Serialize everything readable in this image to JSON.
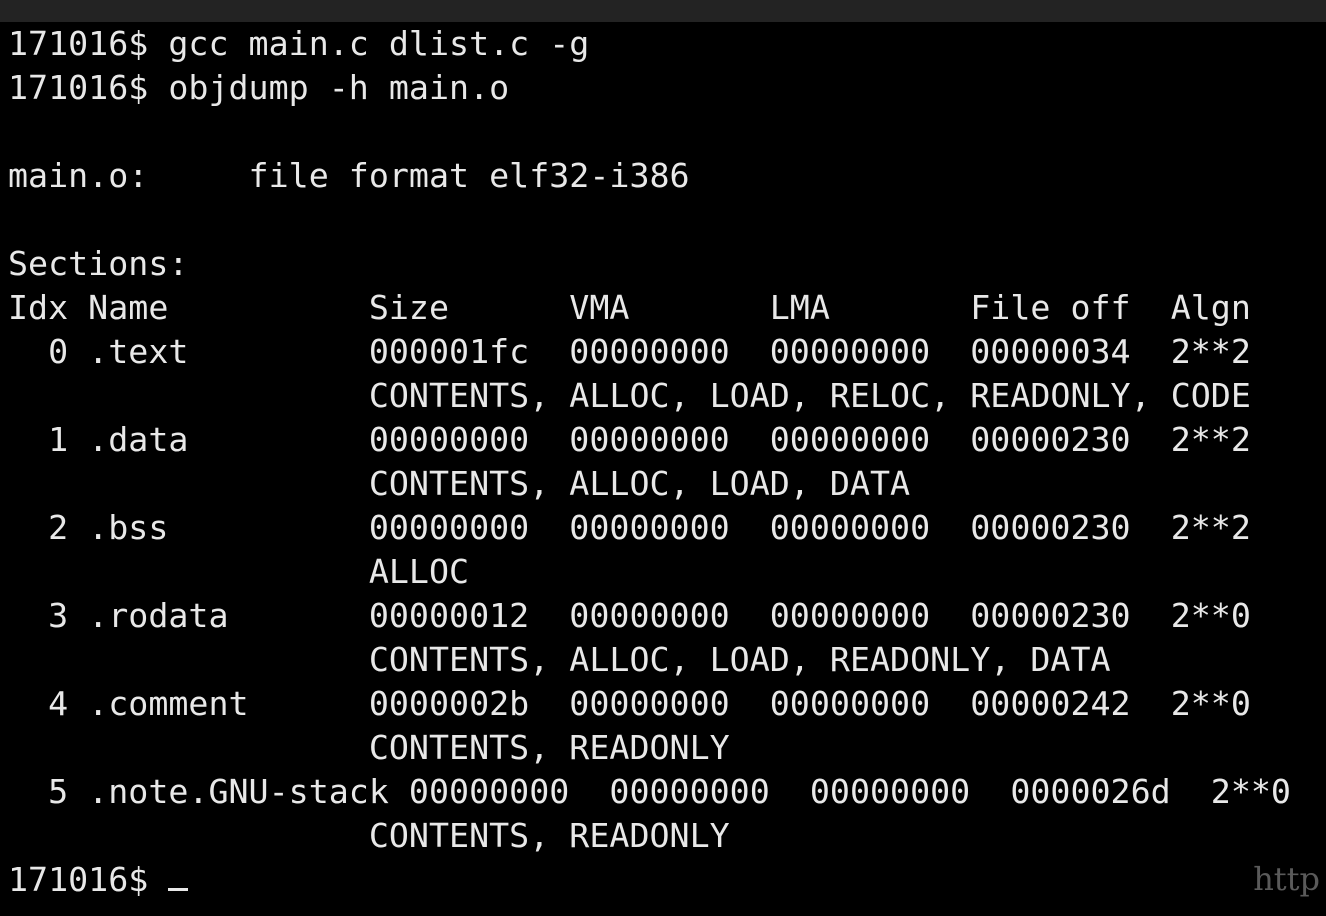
{
  "terminal": {
    "lines": [
      "171016$ gcc main.c dlist.c -g",
      "171016$ objdump -h main.o",
      "",
      "main.o:     file format elf32-i386",
      "",
      "Sections:",
      "Idx Name          Size      VMA       LMA       File off  Algn",
      "  0 .text         000001fc  00000000  00000000  00000034  2**2",
      "                  CONTENTS, ALLOC, LOAD, RELOC, READONLY, CODE",
      "  1 .data         00000000  00000000  00000000  00000230  2**2",
      "                  CONTENTS, ALLOC, LOAD, DATA",
      "  2 .bss          00000000  00000000  00000000  00000230  2**2",
      "                  ALLOC",
      "  3 .rodata       00000012  00000000  00000000  00000230  2**0",
      "                  CONTENTS, ALLOC, LOAD, READONLY, DATA",
      "  4 .comment      0000002b  00000000  00000000  00000242  2**0",
      "                  CONTENTS, READONLY",
      "  5 .note.GNU-stack 00000000  00000000  00000000  0000026d  2**0",
      "                  CONTENTS, READONLY"
    ],
    "prompt": "171016$ "
  },
  "watermark": "http",
  "colors": {
    "background": "#000000",
    "text": "#e8e8e8",
    "top_bar": "#232323"
  }
}
